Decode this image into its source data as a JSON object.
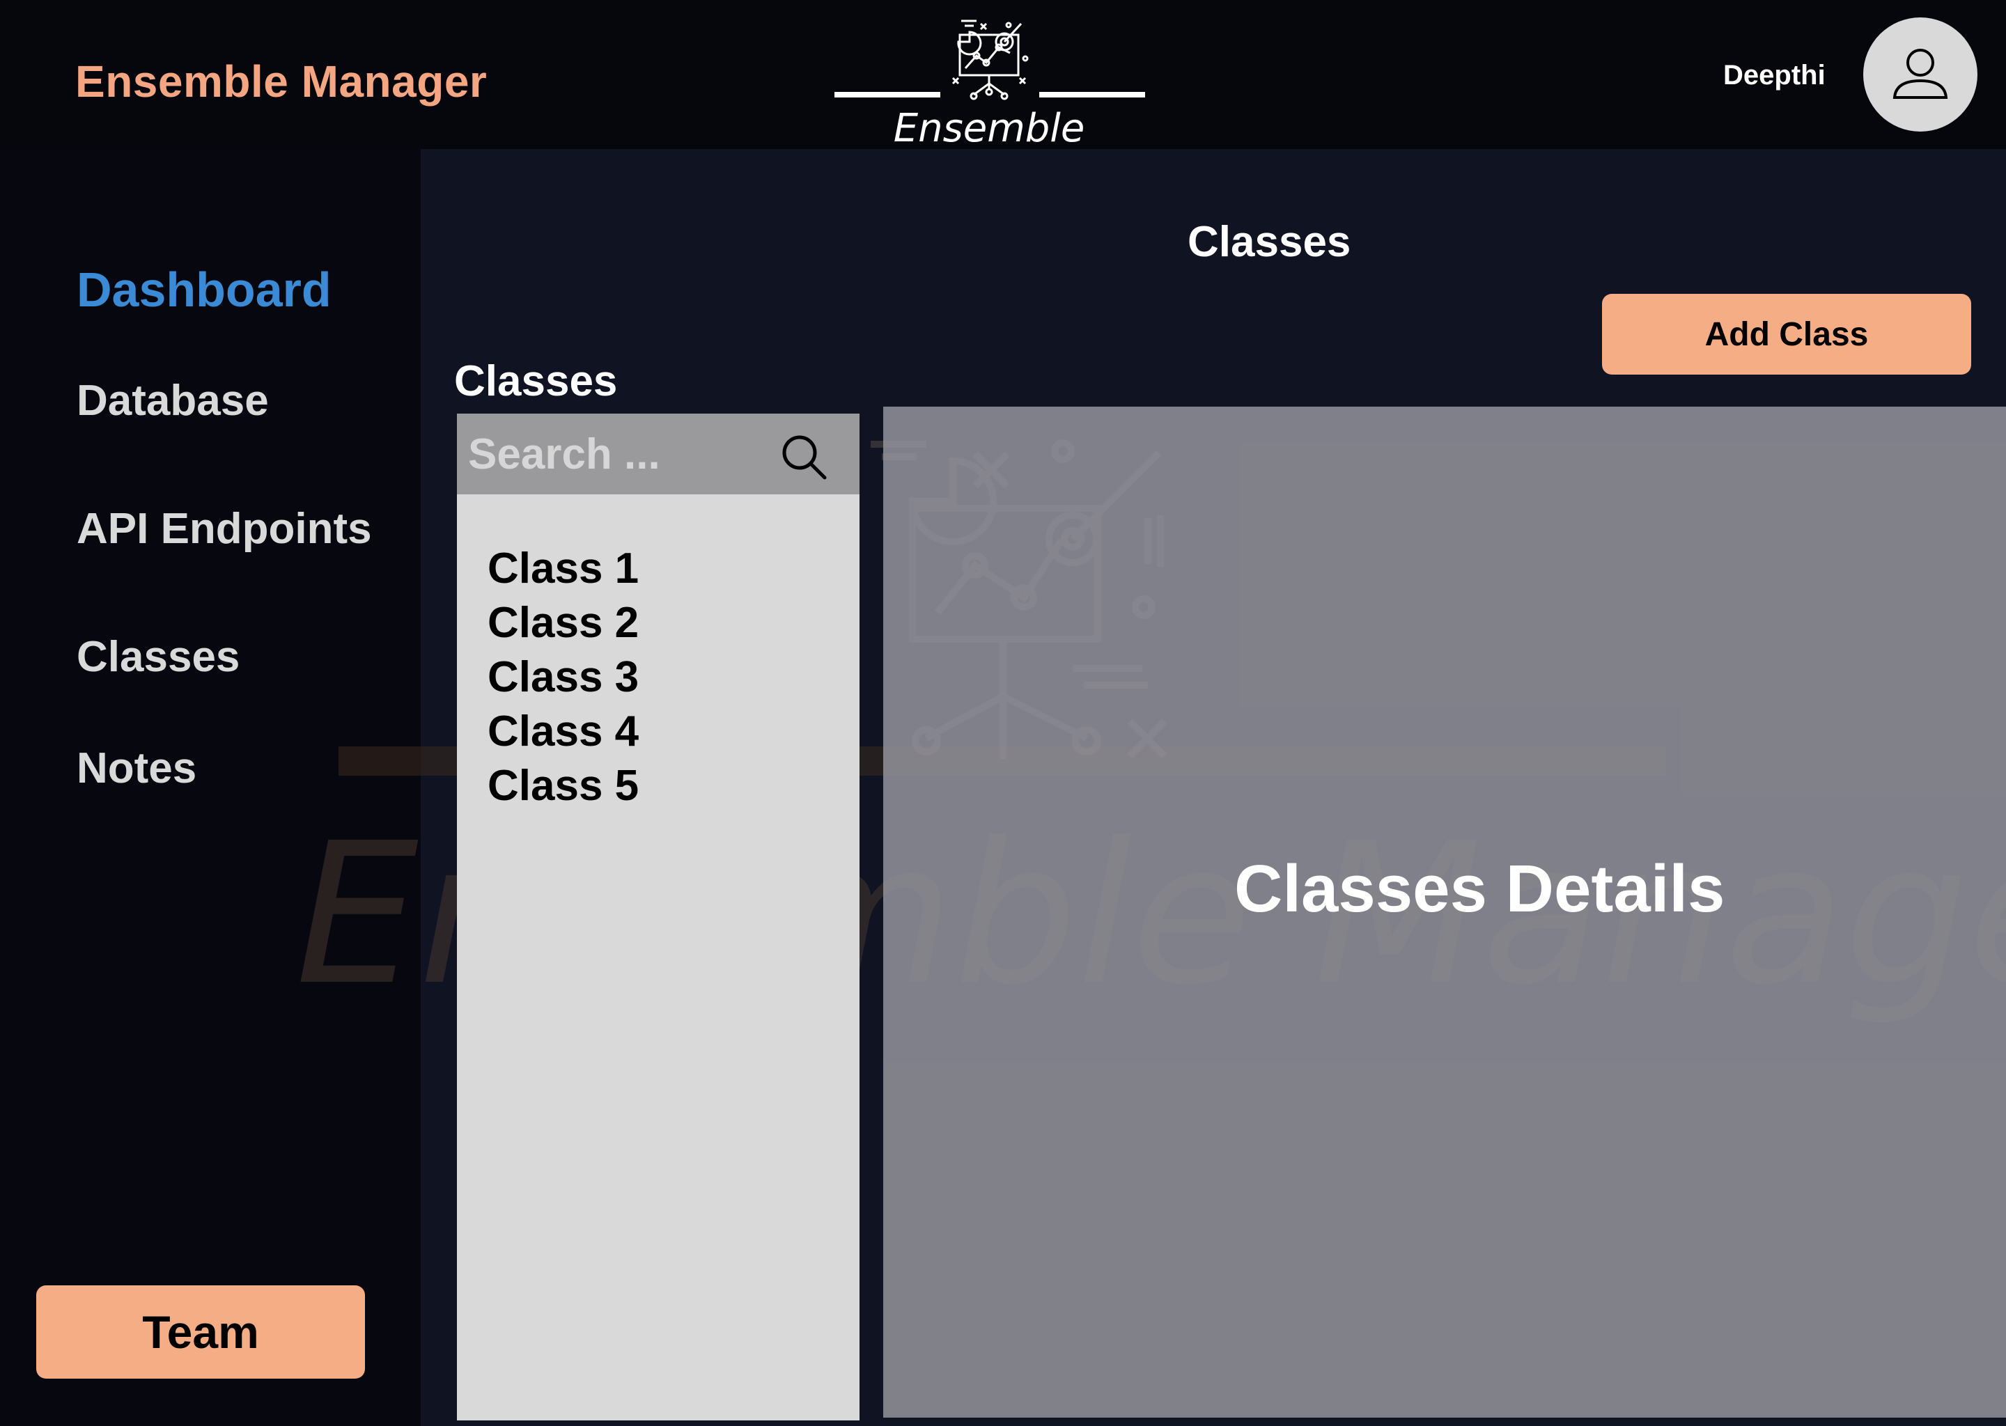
{
  "header": {
    "brand_title": "Ensemble Manager",
    "logo_text": "Ensemble Manager",
    "user_name": "Deepthi",
    "avatar_icon": "user-icon"
  },
  "sidebar": {
    "items": [
      {
        "label": "Dashboard",
        "active": true
      },
      {
        "label": "Database",
        "active": false
      },
      {
        "label": "API Endpoints",
        "active": false
      },
      {
        "label": "Classes",
        "active": false
      },
      {
        "label": "Notes",
        "active": false
      }
    ],
    "team_label": "Team"
  },
  "main": {
    "page_title": "Classes",
    "add_class_label": "Add Class",
    "list_title": "Classes",
    "search": {
      "placeholder": "Search ...",
      "value": "",
      "icon": "search-icon"
    },
    "classes": [
      "Class 1",
      "Class 2",
      "Class 3",
      "Class 4",
      "Class 5"
    ],
    "details_title": "Classes Details",
    "watermark_text": "Ensemble Manager"
  },
  "colors": {
    "accent": "#f4ad84",
    "brand_text": "#f4a582",
    "active_nav": "#3a8ad6",
    "background": "#0f1322",
    "sidebar": "#07080f"
  }
}
